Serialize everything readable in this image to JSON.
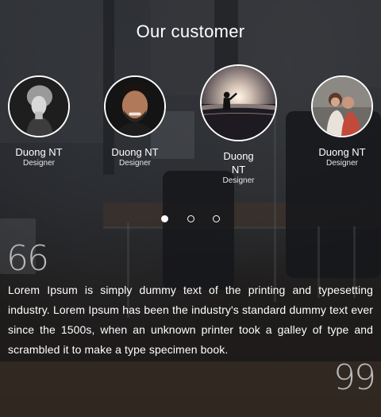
{
  "section": {
    "title": "Our customer"
  },
  "customers": [
    {
      "name": "Duong NT",
      "role": "Designer",
      "photo": "woman-portrait-bw"
    },
    {
      "name": "Duong NT",
      "role": "Designer",
      "photo": "smiling-man-portrait"
    },
    {
      "name": "Duong NT",
      "role": "Designer",
      "photo": "child-in-sea-sunset",
      "active": true
    },
    {
      "name": "Duong NT",
      "role": "Designer",
      "photo": "couple-portrait"
    }
  ],
  "pager": {
    "count": 3,
    "active_index": 0
  },
  "testimonial": {
    "open_quote": "66",
    "close_quote": "99",
    "text": "Lorem Ipsum is simply dummy text of the printing and typesetting industry. Lorem Ipsum has been the industry's standard dummy text ever since the 1500s, when an unknown printer took a galley of type and scrambled it to make a type specimen book."
  },
  "colors": {
    "accent": "#ffffff",
    "overlay": "#121418"
  }
}
